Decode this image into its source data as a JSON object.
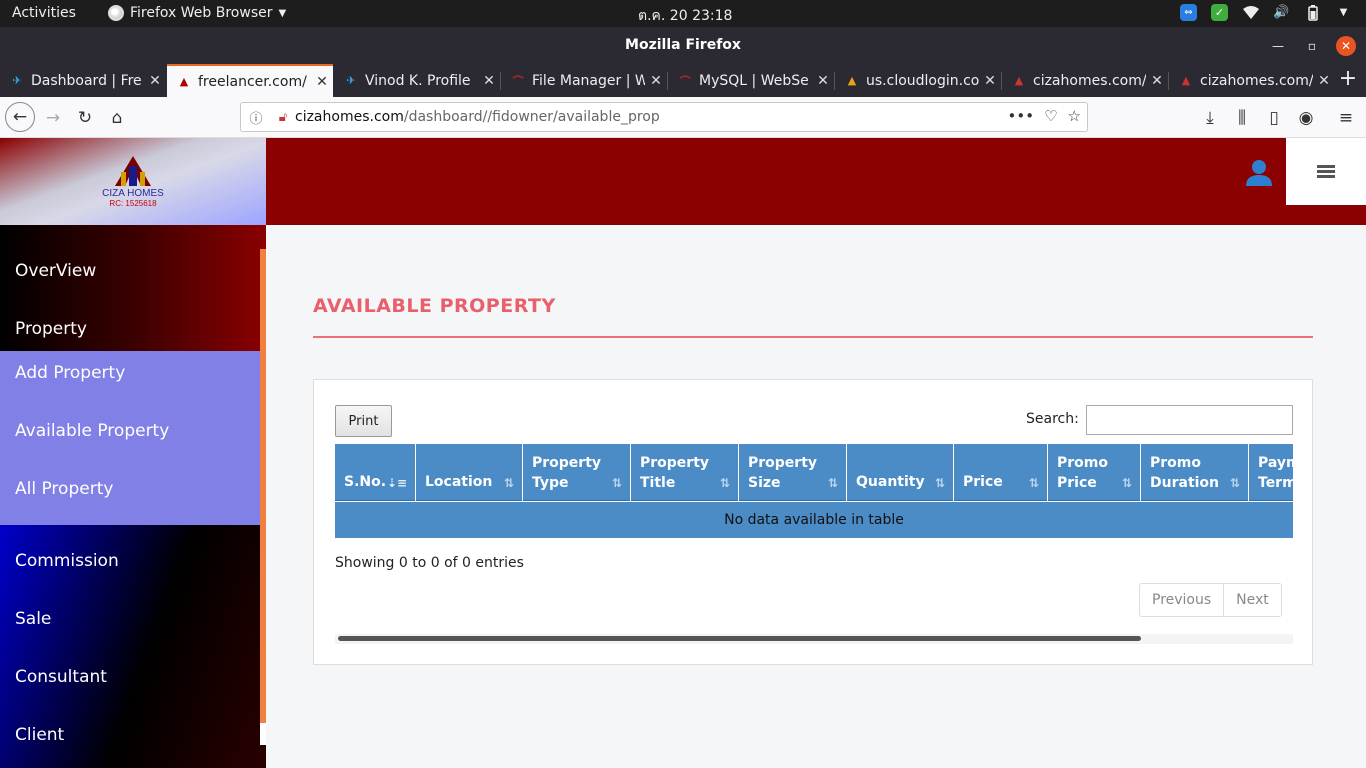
{
  "gnome": {
    "activities": "Activities",
    "app_menu": "Firefox Web Browser",
    "clock": "ต.ค. 20  23:18"
  },
  "window": {
    "title": "Mozilla Firefox"
  },
  "tabs": [
    {
      "label": "Dashboard | Fre",
      "favicon": "freelancer-icon"
    },
    {
      "label": "freelancer.com/",
      "favicon": "cizahomes-icon",
      "active": true
    },
    {
      "label": "Vinod K. Profile",
      "favicon": "freelancer-icon"
    },
    {
      "label": "File Manager | W",
      "favicon": "webserver-icon"
    },
    {
      "label": "MySQL | WebSe",
      "favicon": "webserver-icon"
    },
    {
      "label": "us.cloudlogin.co",
      "favicon": "cloudlogin-icon"
    },
    {
      "label": "cizahomes.com/",
      "favicon": "cizahomes-icon"
    },
    {
      "label": "cizahomes.com/",
      "favicon": "cizahomes-icon"
    }
  ],
  "url": {
    "host": "cizahomes.com",
    "path": "/dashboard//fidowner/available_prop"
  },
  "brand": {
    "name": "CIZA HOMES",
    "rc": "RC: 1525618"
  },
  "sidebar": {
    "items": [
      {
        "label": "OverView"
      },
      {
        "label": "Property"
      }
    ],
    "submenu": [
      {
        "label": "Add Property"
      },
      {
        "label": "Available Property"
      },
      {
        "label": "All Property"
      }
    ],
    "lower_items": [
      {
        "label": "Commission"
      },
      {
        "label": "Sale"
      },
      {
        "label": "Consultant"
      },
      {
        "label": "Client"
      }
    ]
  },
  "main": {
    "title": "AVAILABLE PROPERTY",
    "print_label": "Print",
    "search_label": "Search:",
    "search_value": "",
    "columns": [
      {
        "line1": "S.No.",
        "line2": ""
      },
      {
        "line1": "Location",
        "line2": ""
      },
      {
        "line1": "Property",
        "line2": "Type"
      },
      {
        "line1": "Property",
        "line2": "Title"
      },
      {
        "line1": "Property",
        "line2": "Size"
      },
      {
        "line1": "Quantity",
        "line2": ""
      },
      {
        "line1": "Price",
        "line2": ""
      },
      {
        "line1": "Promo",
        "line2": "Price"
      },
      {
        "line1": "Promo",
        "line2": "Duration"
      },
      {
        "line1": "Paym",
        "line2": "Term"
      }
    ],
    "empty_message": "No data available in table",
    "info": "Showing 0 to 0 of 0 entries",
    "pager": {
      "previous": "Previous",
      "next": "Next"
    }
  },
  "colors": {
    "header_red": "#8b0000",
    "title_pink": "#e8606c",
    "table_blue": "#4b8bc6",
    "submenu_lavender": "#8080e6"
  }
}
